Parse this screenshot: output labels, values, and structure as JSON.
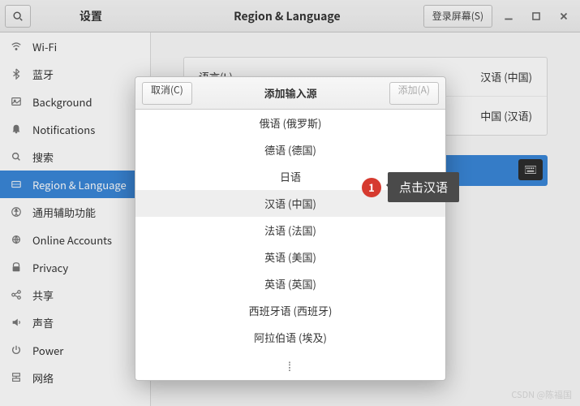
{
  "header": {
    "left_title": "设置",
    "center_title": "Region & Language",
    "login_screen_btn": "登录屏幕(S)"
  },
  "sidebar": {
    "items": [
      {
        "icon": "wifi",
        "label": "Wi-Fi"
      },
      {
        "icon": "bluetooth",
        "label": "蓝牙"
      },
      {
        "icon": "background",
        "label": "Background"
      },
      {
        "icon": "bell",
        "label": "Notifications"
      },
      {
        "icon": "search",
        "label": "搜索"
      },
      {
        "icon": "region",
        "label": "Region & Language"
      },
      {
        "icon": "access",
        "label": "通用辅助功能"
      },
      {
        "icon": "online",
        "label": "Online Accounts"
      },
      {
        "icon": "privacy",
        "label": "Privacy"
      },
      {
        "icon": "share",
        "label": "共享"
      },
      {
        "icon": "sound",
        "label": "声音"
      },
      {
        "icon": "power",
        "label": "Power"
      },
      {
        "icon": "network",
        "label": "网络"
      }
    ],
    "active_index": 5
  },
  "content": {
    "language_label": "语言(L)",
    "language_value": "汉语 (中国)",
    "format_label": "",
    "format_value": "中国 (汉语)"
  },
  "dialog": {
    "title": "添加输入源",
    "cancel": "取消(C)",
    "add": "添加(A)",
    "items": [
      "俄语 (俄罗斯)",
      "德语 (德国)",
      "日语",
      "汉语 (中国)",
      "法语 (法国)",
      "英语 (美国)",
      "英语 (英国)",
      "西班牙语 (西班牙)",
      "阿拉伯语 (埃及)"
    ],
    "selected_index": 3
  },
  "annotation": {
    "badge": "1",
    "tip": "点击汉语"
  },
  "watermark": "CSDN @陈福国"
}
